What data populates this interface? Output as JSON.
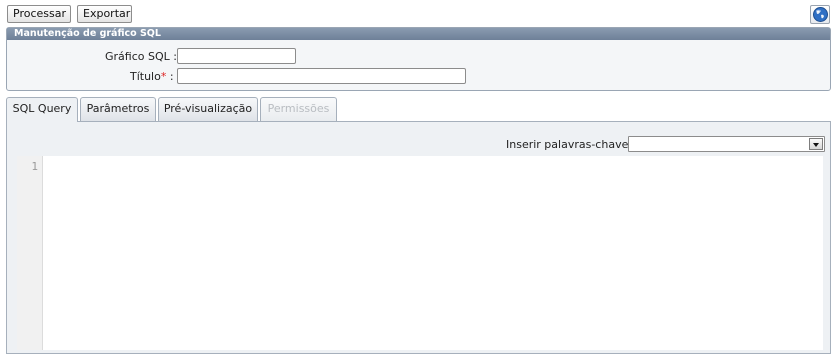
{
  "toolbar": {
    "process_label": "Processar",
    "export_label": "Exportar"
  },
  "help": {
    "icon": "help-globe-icon"
  },
  "form": {
    "title": "Manutenção de gráfico SQL",
    "sql_chart_label": "Gráfico SQL :",
    "sql_chart_value": "",
    "title_label": "Título",
    "title_required_mark": "*",
    "title_colon": " :",
    "title_value": ""
  },
  "tabs": [
    {
      "label": "SQL Query",
      "active": true,
      "enabled": true
    },
    {
      "label": "Parâmetros",
      "active": false,
      "enabled": true
    },
    {
      "label": "Pré-visualização",
      "active": false,
      "enabled": true
    },
    {
      "label": "Permissões",
      "active": false,
      "enabled": false
    }
  ],
  "query": {
    "keywords_label": "Inserir palavras-chave:",
    "keywords_selected": "",
    "line_numbers": [
      "1"
    ],
    "code": ""
  }
}
